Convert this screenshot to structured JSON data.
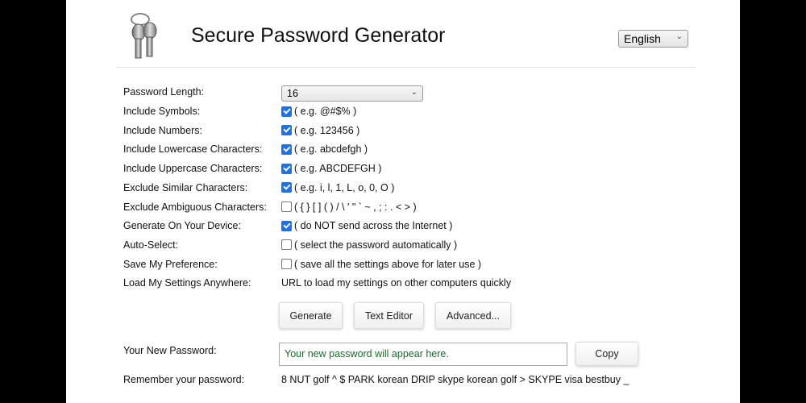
{
  "header": {
    "title": "Secure Password Generator",
    "language": "English",
    "logo_icon": "keys-icon"
  },
  "length": {
    "label": "Password Length:",
    "value": "16"
  },
  "options": [
    {
      "label": "Include Symbols:",
      "hint": "( e.g. @#$% )",
      "checked": true
    },
    {
      "label": "Include Numbers:",
      "hint": "( e.g. 123456 )",
      "checked": true
    },
    {
      "label": "Include Lowercase Characters:",
      "hint": "( e.g. abcdefgh )",
      "checked": true
    },
    {
      "label": "Include Uppercase Characters:",
      "hint": "( e.g. ABCDEFGH )",
      "checked": true
    },
    {
      "label": "Exclude Similar Characters:",
      "hint": "( e.g. i, l, 1, L, o, 0, O )",
      "checked": true
    },
    {
      "label": "Exclude Ambiguous Characters:",
      "hint": "( { } [ ] ( ) / \\ ' \" ` ~ , ; : . < > )",
      "checked": false
    },
    {
      "label": "Generate On Your Device:",
      "hint": "( do NOT send across the Internet )",
      "checked": true
    },
    {
      "label": "Auto-Select:",
      "hint": "( select the password automatically )",
      "checked": false
    },
    {
      "label": "Save My Preference:",
      "hint": "( save all the settings above for later use )",
      "checked": false
    }
  ],
  "load": {
    "label": "Load My Settings Anywhere:",
    "text": "URL to load my settings on other computers quickly"
  },
  "buttons": {
    "generate": "Generate",
    "text_editor": "Text Editor",
    "advanced": "Advanced...",
    "copy": "Copy"
  },
  "result": {
    "label": "Your New Password:",
    "placeholder": "Your new password will appear here.",
    "remember_label": "Remember your password:",
    "remember_text": "8 NUT golf ^ $ PARK korean DRIP skype korean golf > SKYPE visa bestbuy _"
  },
  "colors": {
    "checkbox": "#1a73e8",
    "placeholder": "#1a6b2a"
  }
}
